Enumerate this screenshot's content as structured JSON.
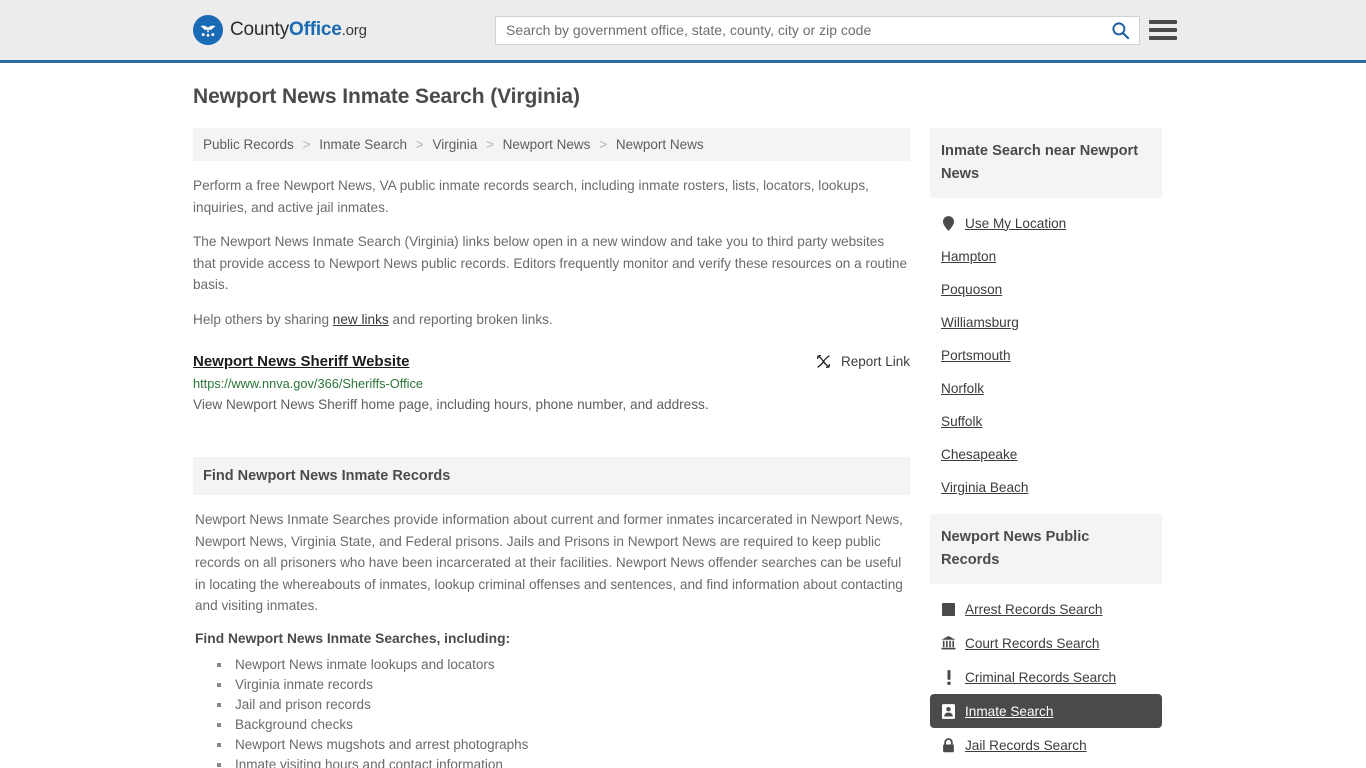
{
  "header": {
    "logo_text_1": "County",
    "logo_text_2": "Office",
    "logo_text_3": ".org",
    "search_placeholder": "Search by government office, state, county, city or zip code",
    "search_value": "",
    "search_icon": "search-icon",
    "menu_icon": "hamburger-menu-icon"
  },
  "page": {
    "title": "Newport News Inmate Search (Virginia)"
  },
  "breadcrumb": {
    "items": [
      {
        "label": "Public Records"
      },
      {
        "label": "Inmate Search"
      },
      {
        "label": "Virginia"
      },
      {
        "label": "Newport News"
      },
      {
        "label": "Newport News"
      }
    ],
    "separator": ">"
  },
  "intro": {
    "p1": "Perform a free Newport News, VA public inmate records search, including inmate rosters, lists, locators, lookups, inquiries, and active jail inmates.",
    "p2": "The Newport News Inmate Search (Virginia) links below open in a new window and take you to third party websites that provide access to Newport News public records. Editors frequently monitor and verify these resources on a routine basis.",
    "p3_before": "Help others by sharing ",
    "p3_link": "new links",
    "p3_after": " and reporting broken links."
  },
  "listing": {
    "title": "Newport News Sheriff Website",
    "report_label": "Report Link",
    "report_icon": "broken-link-icon",
    "url": "https://www.nnva.gov/366/Sheriffs-Office",
    "description": "View Newport News Sheriff home page, including hours, phone number, and address."
  },
  "section": {
    "heading": "Find Newport News Inmate Records",
    "paragraph": "Newport News Inmate Searches provide information about current and former inmates incarcerated in Newport News, Newport News, Virginia State, and Federal prisons. Jails and Prisons in Newport News are required to keep public records on all prisoners who have been incarcerated at their facilities. Newport News offender searches can be useful in locating the whereabouts of inmates, lookup criminal offenses and sentences, and find information about contacting and visiting inmates.",
    "sub_heading": "Find Newport News Inmate Searches, including:",
    "bullets": [
      "Newport News inmate lookups and locators",
      "Virginia inmate records",
      "Jail and prison records",
      "Background checks",
      "Newport News mugshots and arrest photographs",
      "Inmate visiting hours and contact information"
    ]
  },
  "sidebar": {
    "nearby": {
      "heading": "Inmate Search near Newport News",
      "items": [
        {
          "label": "Use My Location",
          "icon": "map-pin-icon",
          "active": false
        },
        {
          "label": "Hampton",
          "icon": "",
          "active": false
        },
        {
          "label": "Poquoson",
          "icon": "",
          "active": false
        },
        {
          "label": "Williamsburg",
          "icon": "",
          "active": false
        },
        {
          "label": "Portsmouth",
          "icon": "",
          "active": false
        },
        {
          "label": "Norfolk",
          "icon": "",
          "active": false
        },
        {
          "label": "Suffolk",
          "icon": "",
          "active": false
        },
        {
          "label": "Chesapeake",
          "icon": "",
          "active": false
        },
        {
          "label": "Virginia Beach",
          "icon": "",
          "active": false
        }
      ]
    },
    "records": {
      "heading": "Newport News Public Records",
      "items": [
        {
          "label": "Arrest Records Search",
          "icon": "fingerprint-square-icon",
          "active": false
        },
        {
          "label": "Court Records Search",
          "icon": "courthouse-icon",
          "active": false
        },
        {
          "label": "Criminal Records Search",
          "icon": "exclamation-icon",
          "active": false
        },
        {
          "label": "Inmate Search",
          "icon": "id-badge-icon",
          "active": true
        },
        {
          "label": "Jail Records Search",
          "icon": "lock-icon",
          "active": false
        }
      ]
    }
  },
  "colors": {
    "brand_blue": "#1a6bb5",
    "header_border": "#2b6ca3",
    "header_bg": "#ececec",
    "box_bg": "#f4f4f4",
    "active_bg": "#4a4a4a",
    "url_green": "#2a7536"
  }
}
